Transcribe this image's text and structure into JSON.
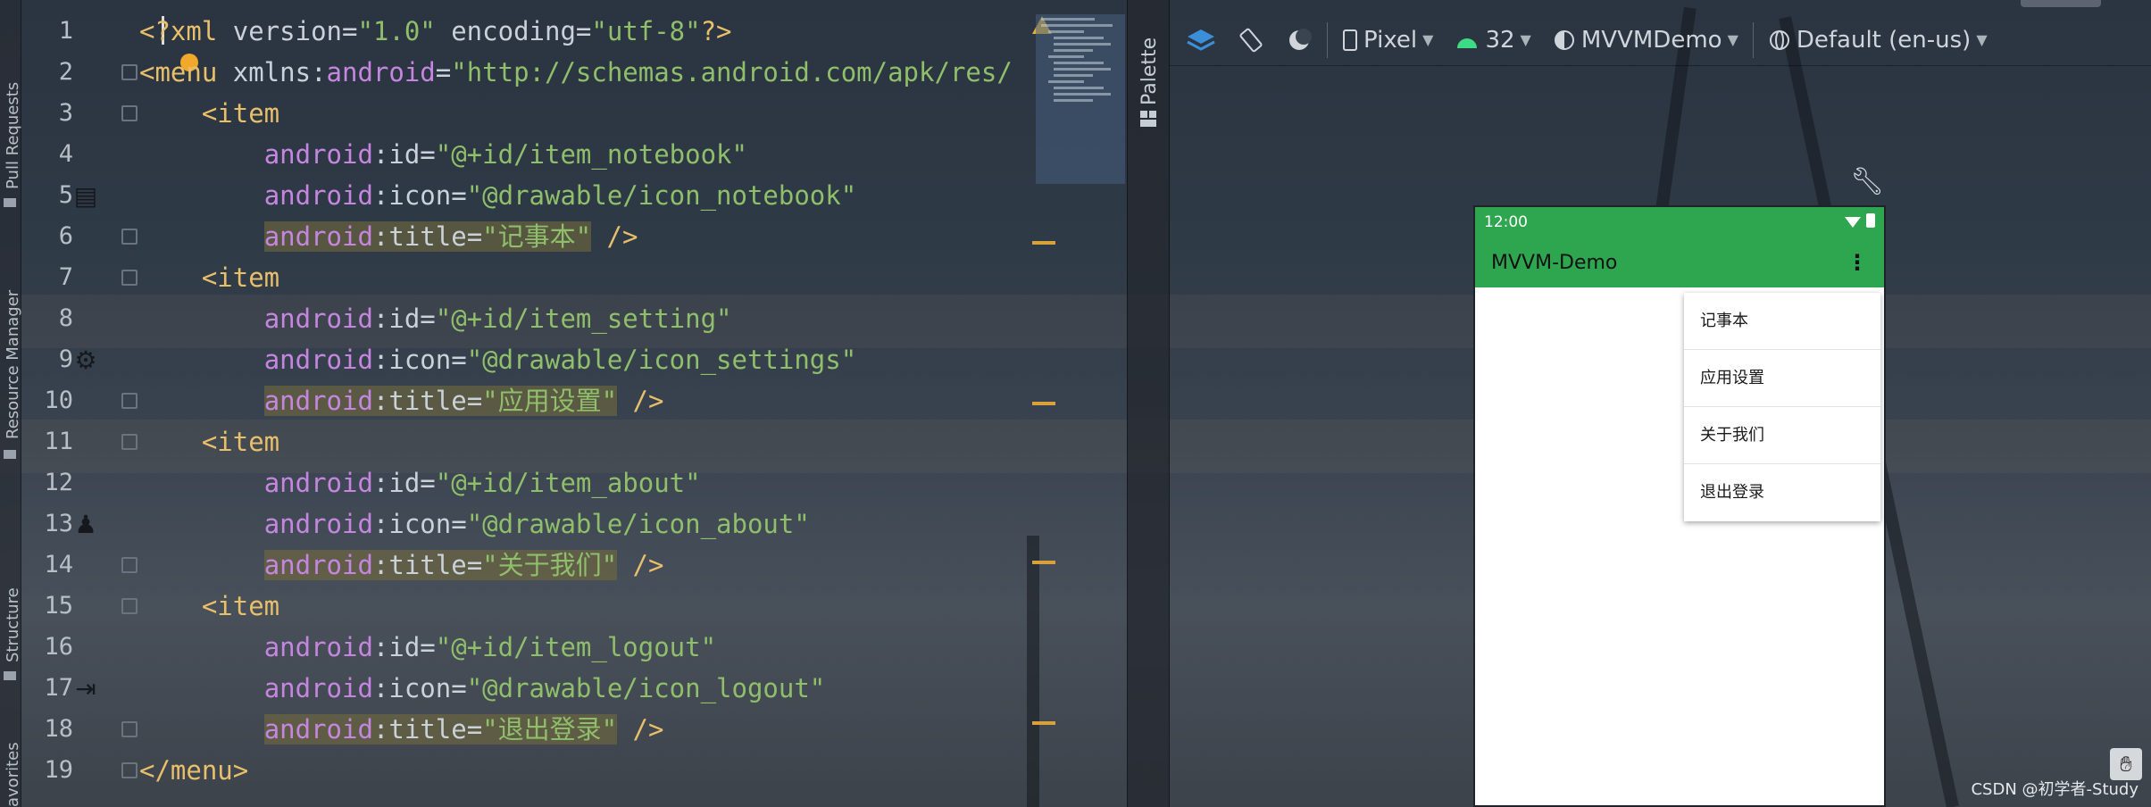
{
  "side_tabs": {
    "pull_requests": "Pull Requests",
    "resource_manager": "Resource Manager",
    "structure": "Structure",
    "favorites": "avorites"
  },
  "editor": {
    "line_numbers": [
      "1",
      "2",
      "3",
      "4",
      "5",
      "6",
      "7",
      "8",
      "9",
      "10",
      "11",
      "12",
      "13",
      "14",
      "15",
      "16",
      "17",
      "18",
      "19"
    ],
    "lines": [
      {
        "indent": "",
        "parts": [
          [
            "t-tag",
            "<?xml "
          ],
          [
            "t-attr",
            "version"
          ],
          [
            "t-punct",
            "="
          ],
          [
            "t-str",
            "\"1.0\""
          ],
          [
            "t-attr",
            " encoding"
          ],
          [
            "t-punct",
            "="
          ],
          [
            "t-str",
            "\"utf-8\""
          ],
          [
            "t-tag",
            "?>"
          ]
        ]
      },
      {
        "indent": "",
        "parts": [
          [
            "t-tag",
            "<menu "
          ],
          [
            "t-attr",
            "xmlns"
          ],
          [
            "t-punct",
            ":"
          ],
          [
            "t-attr-ns",
            "android"
          ],
          [
            "t-punct",
            "="
          ],
          [
            "t-str",
            "\"http://schemas.android.com/apk/res/"
          ]
        ]
      },
      {
        "indent": "    ",
        "parts": [
          [
            "t-tag",
            "<item"
          ]
        ]
      },
      {
        "indent": "        ",
        "parts": [
          [
            "t-attr-ns",
            "android"
          ],
          [
            "t-punct",
            ":"
          ],
          [
            "t-attr",
            "id"
          ],
          [
            "t-punct",
            "="
          ],
          [
            "t-str",
            "\"@+id/item_notebook\""
          ]
        ]
      },
      {
        "indent": "        ",
        "parts": [
          [
            "t-attr-ns",
            "android"
          ],
          [
            "t-punct",
            ":"
          ],
          [
            "t-attr",
            "icon"
          ],
          [
            "t-punct",
            "="
          ],
          [
            "t-str",
            "\"@drawable/icon_notebook\""
          ]
        ]
      },
      {
        "indent": "        ",
        "hl": true,
        "parts": [
          [
            "t-attr-ns",
            "android"
          ],
          [
            "t-punct",
            ":"
          ],
          [
            "t-attr",
            "title"
          ],
          [
            "t-punct",
            "="
          ],
          [
            "t-str",
            "\"记事本\""
          ]
        ],
        "tail": " />"
      },
      {
        "indent": "    ",
        "parts": [
          [
            "t-tag",
            "<item"
          ]
        ]
      },
      {
        "indent": "        ",
        "parts": [
          [
            "t-attr-ns",
            "android"
          ],
          [
            "t-punct",
            ":"
          ],
          [
            "t-attr",
            "id"
          ],
          [
            "t-punct",
            "="
          ],
          [
            "t-str",
            "\"@+id/item_setting\""
          ]
        ]
      },
      {
        "indent": "        ",
        "parts": [
          [
            "t-attr-ns",
            "android"
          ],
          [
            "t-punct",
            ":"
          ],
          [
            "t-attr",
            "icon"
          ],
          [
            "t-punct",
            "="
          ],
          [
            "t-str",
            "\"@drawable/icon_settings\""
          ]
        ]
      },
      {
        "indent": "        ",
        "hl": true,
        "parts": [
          [
            "t-attr-ns",
            "android"
          ],
          [
            "t-punct",
            ":"
          ],
          [
            "t-attr",
            "title"
          ],
          [
            "t-punct",
            "="
          ],
          [
            "t-str",
            "\"应用设置\""
          ]
        ],
        "tail": " />"
      },
      {
        "indent": "    ",
        "parts": [
          [
            "t-tag",
            "<item"
          ]
        ]
      },
      {
        "indent": "        ",
        "parts": [
          [
            "t-attr-ns",
            "android"
          ],
          [
            "t-punct",
            ":"
          ],
          [
            "t-attr",
            "id"
          ],
          [
            "t-punct",
            "="
          ],
          [
            "t-str",
            "\"@+id/item_about\""
          ]
        ]
      },
      {
        "indent": "        ",
        "parts": [
          [
            "t-attr-ns",
            "android"
          ],
          [
            "t-punct",
            ":"
          ],
          [
            "t-attr",
            "icon"
          ],
          [
            "t-punct",
            "="
          ],
          [
            "t-str",
            "\"@drawable/icon_about\""
          ]
        ]
      },
      {
        "indent": "        ",
        "hl": true,
        "parts": [
          [
            "t-attr-ns",
            "android"
          ],
          [
            "t-punct",
            ":"
          ],
          [
            "t-attr",
            "title"
          ],
          [
            "t-punct",
            "="
          ],
          [
            "t-str",
            "\"关于我们\""
          ]
        ],
        "tail": " />"
      },
      {
        "indent": "    ",
        "parts": [
          [
            "t-tag",
            "<item"
          ]
        ]
      },
      {
        "indent": "        ",
        "parts": [
          [
            "t-attr-ns",
            "android"
          ],
          [
            "t-punct",
            ":"
          ],
          [
            "t-attr",
            "id"
          ],
          [
            "t-punct",
            "="
          ],
          [
            "t-str",
            "\"@+id/item_logout\""
          ]
        ]
      },
      {
        "indent": "        ",
        "parts": [
          [
            "t-attr-ns",
            "android"
          ],
          [
            "t-punct",
            ":"
          ],
          [
            "t-attr",
            "icon"
          ],
          [
            "t-punct",
            "="
          ],
          [
            "t-str",
            "\"@drawable/icon_logout\""
          ]
        ]
      },
      {
        "indent": "        ",
        "hl": true,
        "parts": [
          [
            "t-attr-ns",
            "android"
          ],
          [
            "t-punct",
            ":"
          ],
          [
            "t-attr",
            "title"
          ],
          [
            "t-punct",
            "="
          ],
          [
            "t-str",
            "\"退出登录\""
          ]
        ],
        "tail": " />"
      },
      {
        "indent": "",
        "parts": [
          [
            "t-tag",
            "</menu>"
          ]
        ]
      }
    ]
  },
  "palette_label": "Palette",
  "toolbar": {
    "device": "Pixel",
    "api_level": "32",
    "theme": "MVVMDemo",
    "locale": "Default (en-us)"
  },
  "phone": {
    "time": "12:00",
    "app_title": "MVVM-Demo",
    "overflow_glyph": "⋮",
    "menu_items": [
      "记事本",
      "应用设置",
      "关于我们",
      "退出登录"
    ]
  },
  "watermark": "CSDN @初学者-Study",
  "colors": {
    "app_bar": "#2ea64f",
    "tag": "#e8bf6a",
    "string": "#8fbf6a",
    "namespace": "#c586e0"
  }
}
